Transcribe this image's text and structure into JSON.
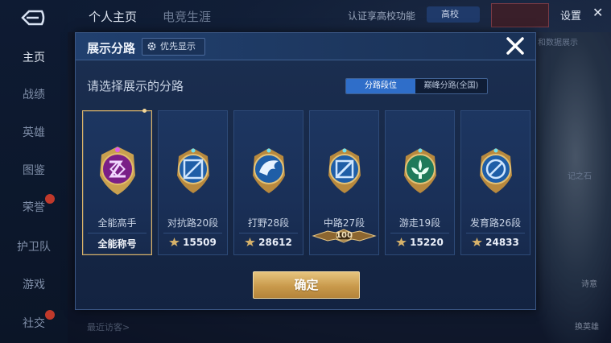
{
  "sidebar": {
    "items": [
      {
        "label": "主页"
      },
      {
        "label": "战绩"
      },
      {
        "label": "英雄"
      },
      {
        "label": "图鉴"
      },
      {
        "label": "荣誉"
      },
      {
        "label": "护卫队"
      },
      {
        "label": "游戏"
      },
      {
        "label": "社交"
      }
    ]
  },
  "topbar": {
    "tab_profile": "个人主页",
    "tab_esports": "电竞生涯",
    "notice": "认证享高校功能",
    "chip": "高校",
    "settings": "设置"
  },
  "background": {
    "recent_visits": "最近访客>",
    "side_link": "和数据展示",
    "side_text": "记之石",
    "btn_left": "诗意",
    "btn_right": "换英雄"
  },
  "modal": {
    "title": "展示分路",
    "priority_button": "优先显示",
    "prompt": "请选择展示的分路",
    "segments": [
      "分路段位",
      "巅峰分路(全国)"
    ],
    "confirm": "确定",
    "cards": [
      {
        "name": "全能高手",
        "label": "全能称号",
        "selected": true
      },
      {
        "name": "对抗路20段",
        "score": "15509"
      },
      {
        "name": "打野28段",
        "score": "28612"
      },
      {
        "name": "中路27段",
        "badge": "100"
      },
      {
        "name": "游走19段",
        "score": "15220"
      },
      {
        "name": "发育路26段",
        "score": "24833"
      }
    ]
  },
  "colors": {
    "accent_gold": "#d9b26a",
    "segment_active": "#2f6ec9",
    "modal_bg": "#1b2f52"
  }
}
